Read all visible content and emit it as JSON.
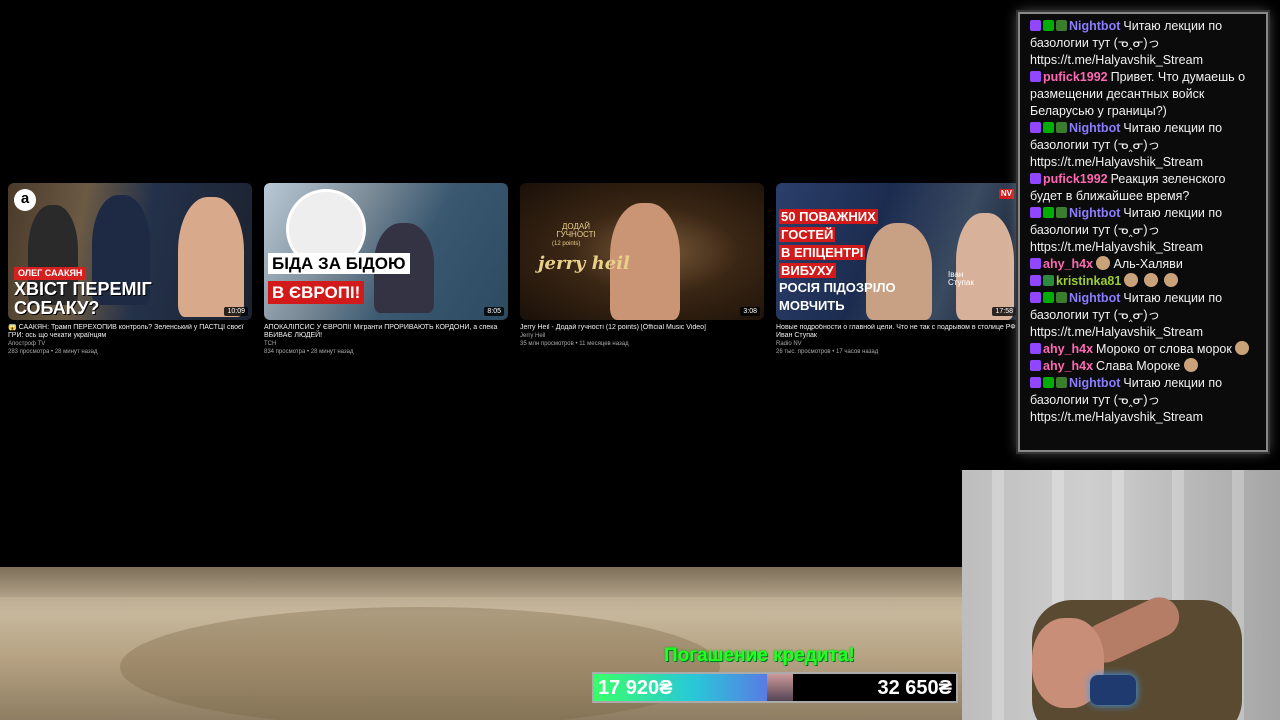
{
  "videos": [
    {
      "overlay_top": "ОЛЕГ СААКЯН",
      "overlay_main": "ХВІСТ ПЕРЕМІГ СОБАКУ?",
      "logo": "a",
      "duration": "10:09",
      "title": "😱 СААКЯН: Трамп ПЕРЕХОПИВ контроль? Зеленський у ПАСТЦІ своєї ГРИ: ось що чекати українцям",
      "channel": "Апостроф TV",
      "meta": "283 просмотра • 28 минут назад"
    },
    {
      "overlay_line1": "БІДА ЗА БІДОЮ",
      "overlay_line2": "В ЄВРОПІ!",
      "duration": "8:05",
      "title": "АПОКАЛІПСИС У ЄВРОПІ! Мігранти ПРОРИВАЮТЬ КОРДОНИ, а спека ВБИВАЄ ЛЮДЕЙ!",
      "channel": "ТСН",
      "meta": "834 просмотра • 28 минут назад"
    },
    {
      "overlay_small": "ДОДАЙ ГУЧНОСТІ",
      "overlay_points": "(12 points)",
      "overlay_brand": "jerry heil",
      "duration": "3:08",
      "title": "Jerry Heil - Додай гучності (12 points) [Official Music Video]",
      "channel": "Jerry Heil",
      "meta": "35 млн просмотров • 11 месяцев назад"
    },
    {
      "overlay_lines": [
        "50 ПОВАЖНИХ",
        "ГОСТЕЙ",
        "В ЕПІЦЕНТРІ",
        "ВИБУХУ",
        "РОСІЯ ПІДОЗРІЛО",
        "МОВЧИТЬ"
      ],
      "overlay_name": "Іван Ступак",
      "logo": "NV",
      "duration": "17:58",
      "title": "Новые подробности о главной цели. Что не так с подрывом в столице РФ | Иван Ступак",
      "channel": "Radio NV",
      "meta": "26 тыс. просмотров • 17 часов назад"
    }
  ],
  "chat": [
    {
      "badges": [
        "b-tw",
        "b-mod",
        "b-bot"
      ],
      "user": "Nightbot",
      "color": "#8c7cff",
      "text": "Читаю лекции по базологии тут (ᓀ‸ᓂ)っ https://t.me/Halyavshik_Stream"
    },
    {
      "badges": [
        "b-tw"
      ],
      "user": "pufick1992",
      "color": "#ff69b4",
      "text": "Привет. Что думаешь о размещении десантных войск Беларусью у границы?)"
    },
    {
      "badges": [
        "b-tw",
        "b-mod",
        "b-bot"
      ],
      "user": "Nightbot",
      "color": "#8c7cff",
      "text": "Читаю лекции по базологии тут (ᓀ‸ᓂ)っ https://t.me/Halyavshik_Stream"
    },
    {
      "badges": [
        "b-tw"
      ],
      "user": "pufick1992",
      "color": "#ff69b4",
      "text": "Реакция зеленского будет в ближайшее время?"
    },
    {
      "badges": [
        "b-tw",
        "b-mod",
        "b-bot"
      ],
      "user": "Nightbot",
      "color": "#8c7cff",
      "text": "Читаю лекции по базологии тут (ᓀ‸ᓂ)っ https://t.me/Halyavshik_Stream"
    },
    {
      "badges": [
        "b-tw"
      ],
      "user": "ahy_h4x",
      "color": "#ff69b4",
      "text": "Аль-Халяви",
      "emote_before": true
    },
    {
      "badges": [
        "b-tw",
        "b-sub"
      ],
      "user": "kristinka81",
      "color": "#9acd32",
      "text": "",
      "emotes": 3
    },
    {
      "badges": [
        "b-tw",
        "b-mod",
        "b-bot"
      ],
      "user": "Nightbot",
      "color": "#8c7cff",
      "text": "Читаю лекции по базологии тут (ᓀ‸ᓂ)っ https://t.me/Halyavshik_Stream"
    },
    {
      "badges": [
        "b-tw"
      ],
      "user": "ahy_h4x",
      "color": "#ff69b4",
      "text": "Мороко от слова морок",
      "emote_after": true
    },
    {
      "badges": [
        "b-tw"
      ],
      "user": "ahy_h4x",
      "color": "#ff69b4",
      "text": "Слава Мороке",
      "emote_after": true
    },
    {
      "badges": [
        "b-tw",
        "b-mod",
        "b-bot"
      ],
      "user": "Nightbot",
      "color": "#8c7cff",
      "text": "Читаю лекции по базологии тут (ᓀ‸ᓂ)っ https://t.me/Halyavshik_Stream"
    }
  ],
  "credit": {
    "title": "Погашение кредита!",
    "current": "17 920₴",
    "goal": "32 650₴",
    "progress": 0.55
  }
}
